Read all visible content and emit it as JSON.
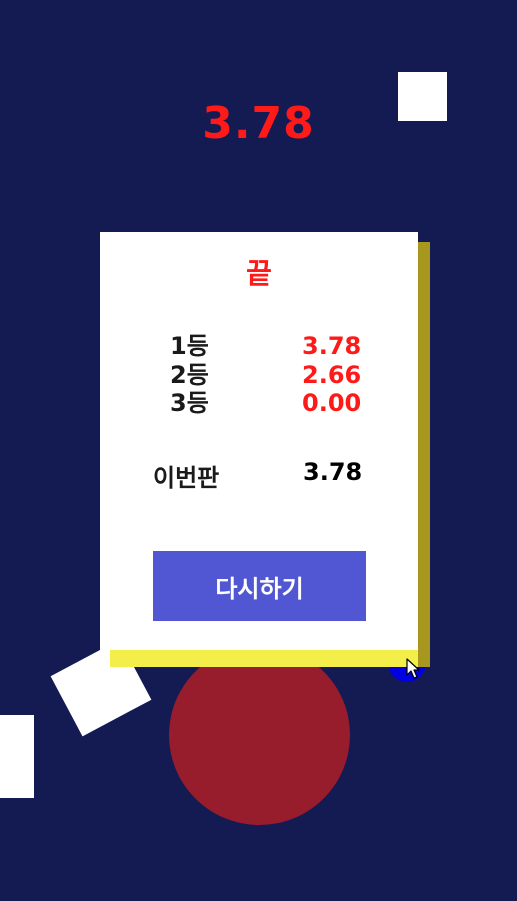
{
  "hud": {
    "score": "3.78"
  },
  "result_panel": {
    "title": "끝",
    "rankings": [
      {
        "label": "1등",
        "value": "3.78"
      },
      {
        "label": "2등",
        "value": "2.66"
      },
      {
        "label": "3등",
        "value": "0.00"
      }
    ],
    "current_label": "이번판",
    "current_value": "3.78",
    "retry_label": "다시하기"
  },
  "colors": {
    "background": "#141a52",
    "score": "#ff1a1a",
    "button": "#5157d2",
    "ball": "#981d2c",
    "panel_shadow": "#a8971f"
  }
}
